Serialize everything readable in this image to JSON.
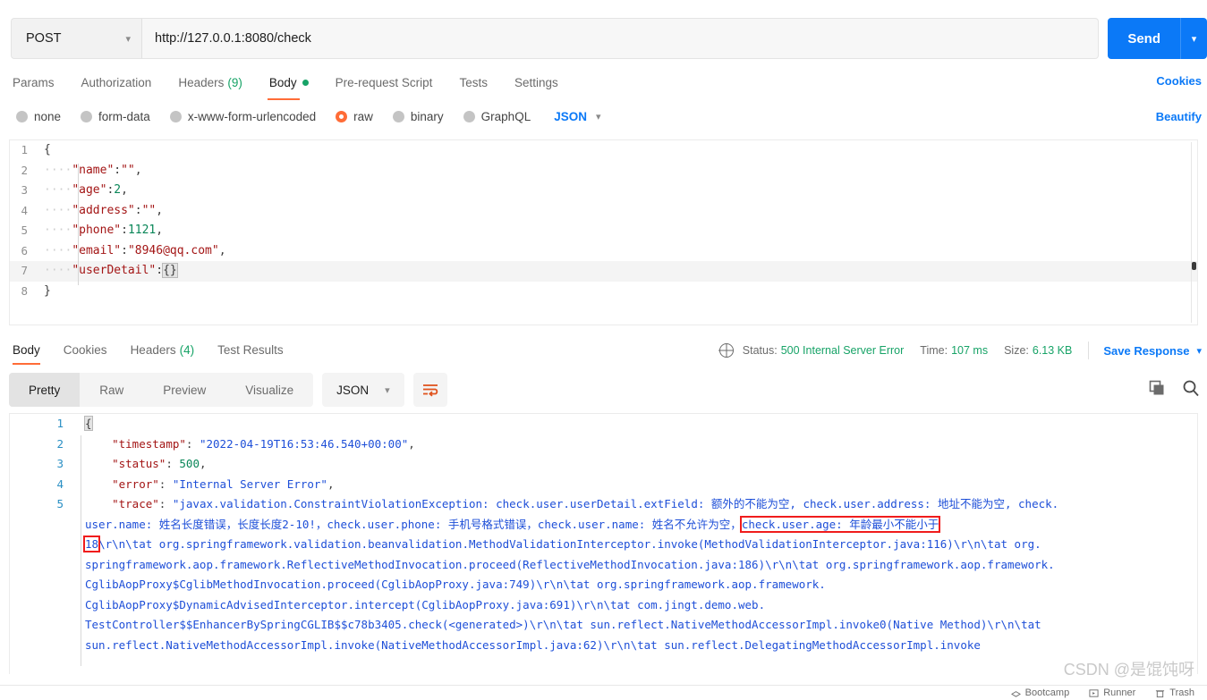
{
  "request": {
    "method": "POST",
    "url": "http://127.0.0.1:8080/check",
    "send_label": "Send",
    "tabs": [
      {
        "label": "Params",
        "badge": "",
        "active": false
      },
      {
        "label": "Authorization",
        "badge": "",
        "active": false
      },
      {
        "label": "Headers",
        "badge": "(9)",
        "active": false
      },
      {
        "label": "Body",
        "badge": "",
        "active": true
      },
      {
        "label": "Pre-request Script",
        "badge": "",
        "active": false
      },
      {
        "label": "Tests",
        "badge": "",
        "active": false
      },
      {
        "label": "Settings",
        "badge": "",
        "active": false
      }
    ],
    "cookies_label": "Cookies",
    "beautify_label": "Beautify",
    "body_types": [
      {
        "label": "none",
        "selected": false
      },
      {
        "label": "form-data",
        "selected": false
      },
      {
        "label": "x-www-form-urlencoded",
        "selected": false
      },
      {
        "label": "raw",
        "selected": true
      },
      {
        "label": "binary",
        "selected": false
      },
      {
        "label": "GraphQL",
        "selected": false
      }
    ],
    "format_selected": "JSON",
    "body_lines": [
      {
        "num": "1",
        "indent": 0,
        "tokens": [
          {
            "t": "{",
            "c": "p"
          }
        ]
      },
      {
        "num": "2",
        "indent": 1,
        "tokens": [
          {
            "t": "\"name\"",
            "c": "k"
          },
          {
            "t": ":",
            "c": "p"
          },
          {
            "t": "\"\"",
            "c": "s"
          },
          {
            "t": ",",
            "c": "p"
          }
        ]
      },
      {
        "num": "3",
        "indent": 1,
        "tokens": [
          {
            "t": "\"age\"",
            "c": "k"
          },
          {
            "t": ":",
            "c": "p"
          },
          {
            "t": "2",
            "c": "n"
          },
          {
            "t": ",",
            "c": "p"
          }
        ]
      },
      {
        "num": "4",
        "indent": 1,
        "tokens": [
          {
            "t": "\"address\"",
            "c": "k"
          },
          {
            "t": ":",
            "c": "p"
          },
          {
            "t": "\"\"",
            "c": "s"
          },
          {
            "t": ",",
            "c": "p"
          }
        ]
      },
      {
        "num": "5",
        "indent": 1,
        "tokens": [
          {
            "t": "\"phone\"",
            "c": "k"
          },
          {
            "t": ":",
            "c": "p"
          },
          {
            "t": "1121",
            "c": "n"
          },
          {
            "t": ",",
            "c": "p"
          }
        ]
      },
      {
        "num": "6",
        "indent": 1,
        "tokens": [
          {
            "t": "\"email\"",
            "c": "k"
          },
          {
            "t": ":",
            "c": "p"
          },
          {
            "t": "\"8946@qq.com\"",
            "c": "s"
          },
          {
            "t": ",",
            "c": "p"
          }
        ]
      },
      {
        "num": "7",
        "indent": 1,
        "highlight": true,
        "tokens": [
          {
            "t": "\"userDetail\"",
            "c": "k"
          },
          {
            "t": ":",
            "c": "p"
          },
          {
            "t": "{}",
            "c": "p",
            "box": true
          }
        ]
      },
      {
        "num": "8",
        "indent": 0,
        "tokens": [
          {
            "t": "}",
            "c": "p"
          }
        ]
      }
    ]
  },
  "response": {
    "tabs": [
      {
        "label": "Body",
        "badge": "",
        "active": true
      },
      {
        "label": "Cookies",
        "badge": "",
        "active": false
      },
      {
        "label": "Headers",
        "badge": "(4)",
        "active": false
      },
      {
        "label": "Test Results",
        "badge": "",
        "active": false
      }
    ],
    "status_label": "Status:",
    "status_value": "500 Internal Server Error",
    "time_label": "Time:",
    "time_value": "107 ms",
    "size_label": "Size:",
    "size_value": "6.13 KB",
    "save_response_label": "Save Response",
    "view_modes": [
      {
        "label": "Pretty",
        "active": true
      },
      {
        "label": "Raw",
        "active": false
      },
      {
        "label": "Preview",
        "active": false
      },
      {
        "label": "Visualize",
        "active": false
      }
    ],
    "format_selected": "JSON",
    "body_lines": [
      {
        "num": "1",
        "segs": [
          {
            "t": "{",
            "c": "jpunc",
            "box": true
          }
        ]
      },
      {
        "num": "2",
        "segs": [
          {
            "t": "    ",
            "c": "jpunc"
          },
          {
            "t": "\"timestamp\"",
            "c": "jkey"
          },
          {
            "t": ": ",
            "c": "jpunc"
          },
          {
            "t": "\"2022-04-19T16:53:46.540+00:00\"",
            "c": "jtext"
          },
          {
            "t": ",",
            "c": "jpunc"
          }
        ]
      },
      {
        "num": "3",
        "segs": [
          {
            "t": "    ",
            "c": "jpunc"
          },
          {
            "t": "\"status\"",
            "c": "jkey"
          },
          {
            "t": ": ",
            "c": "jpunc"
          },
          {
            "t": "500",
            "c": "jnum"
          },
          {
            "t": ",",
            "c": "jpunc"
          }
        ]
      },
      {
        "num": "4",
        "segs": [
          {
            "t": "    ",
            "c": "jpunc"
          },
          {
            "t": "\"error\"",
            "c": "jkey"
          },
          {
            "t": ": ",
            "c": "jpunc"
          },
          {
            "t": "\"Internal Server Error\"",
            "c": "jtext"
          },
          {
            "t": ",",
            "c": "jpunc"
          }
        ]
      },
      {
        "num": "5",
        "segs": [
          {
            "t": "    ",
            "c": "jpunc"
          },
          {
            "t": "\"trace\"",
            "c": "jkey"
          },
          {
            "t": ": ",
            "c": "jpunc"
          },
          {
            "t": "\"javax.validation.ConstraintViolationException: check.user.userDetail.extField: 额外的不能为空, check.user.address: 地址不能为空, check.",
            "c": "jtext"
          }
        ]
      },
      {
        "num": "",
        "segs": [
          {
            "t": "user.name: 姓名长度错误，长度长度2-10!，check.user.phone: 手机号格式错误，check.user.name: 姓名不允许为空，",
            "c": "jtext"
          },
          {
            "t": "check.user.age: 年龄最小不能小于",
            "c": "jtext",
            "box": true
          }
        ]
      },
      {
        "num": "",
        "segs": [
          {
            "t": "18",
            "c": "jtext",
            "box": true
          },
          {
            "t": "\\r\\n\\tat org.springframework.validation.beanvalidation.MethodValidationInterceptor.invoke(MethodValidationInterceptor.java:116)\\r\\n\\tat org.",
            "c": "jtext"
          }
        ]
      },
      {
        "num": "",
        "segs": [
          {
            "t": "springframework.aop.framework.ReflectiveMethodInvocation.proceed(ReflectiveMethodInvocation.java:186)\\r\\n\\tat org.springframework.aop.framework.",
            "c": "jtext"
          }
        ]
      },
      {
        "num": "",
        "segs": [
          {
            "t": "CglibAopProxy$CglibMethodInvocation.proceed(CglibAopProxy.java:749)\\r\\n\\tat org.springframework.aop.framework.",
            "c": "jtext"
          }
        ]
      },
      {
        "num": "",
        "segs": [
          {
            "t": "CglibAopProxy$DynamicAdvisedInterceptor.intercept(CglibAopProxy.java:691)\\r\\n\\tat com.jingt.demo.web.",
            "c": "jtext"
          }
        ]
      },
      {
        "num": "",
        "segs": [
          {
            "t": "TestController$$EnhancerBySpringCGLIB$$c78b3405.check(<generated>)\\r\\n\\tat sun.reflect.NativeMethodAccessorImpl.invoke0(Native Method)\\r\\n\\tat",
            "c": "jtext"
          }
        ]
      },
      {
        "num": "",
        "segs": [
          {
            "t": "sun.reflect.NativeMethodAccessorImpl.invoke(NativeMethodAccessorImpl.java:62)\\r\\n\\tat sun.reflect.DelegatingMethodAccessorImpl.invoke",
            "c": "jtext"
          }
        ]
      }
    ]
  },
  "watermark": "CSDN @是馄饨呀",
  "bottom_bar": [
    {
      "label": "Bootcamp",
      "icon": "bootcamp-icon"
    },
    {
      "label": "Runner",
      "icon": "runner-icon"
    },
    {
      "label": "Trash",
      "icon": "trash-icon"
    }
  ],
  "colors": {
    "accent_orange": "#ff6c37",
    "blue": "#0b79f7",
    "green": "#17a367",
    "red_box": "#f01c1c"
  }
}
